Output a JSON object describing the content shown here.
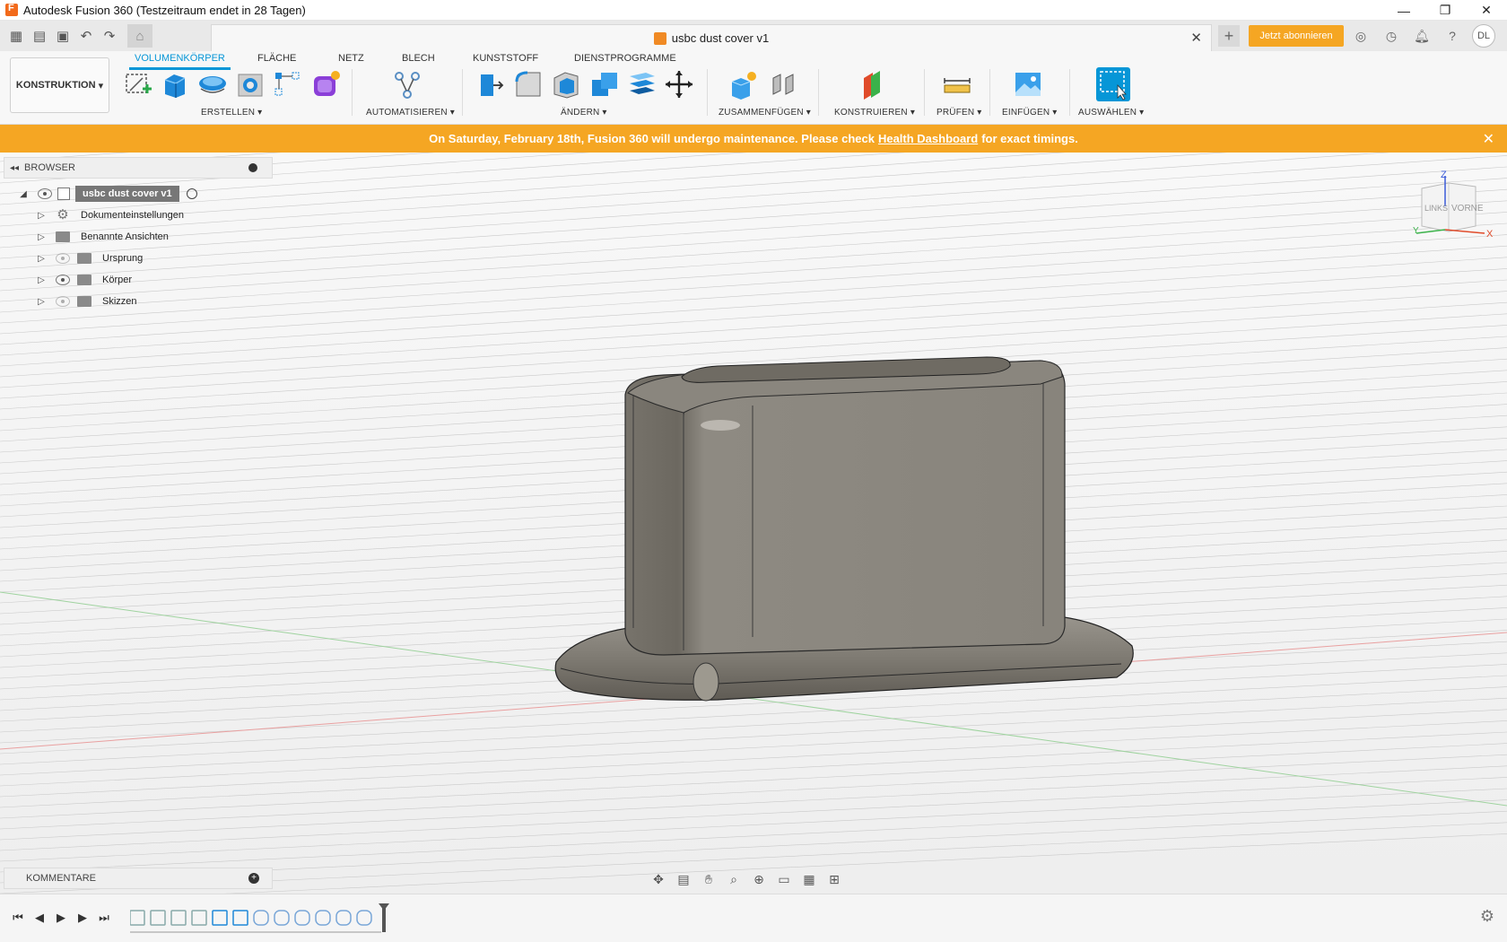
{
  "window": {
    "title": "Autodesk Fusion 360 (Testzeitraum endet in 28 Tagen)",
    "controls": [
      "—",
      "❐",
      "✕"
    ]
  },
  "document": {
    "tab_name": "usbc dust cover v1",
    "subscribe_label": "Jetzt abonnieren",
    "avatar_initials": "DL"
  },
  "toolbar": {
    "workspace": "KONSTRUKTION",
    "tabs": [
      "VOLUMENKÖRPER",
      "FLÄCHE",
      "NETZ",
      "BLECH",
      "KUNSTSTOFF",
      "DIENSTPROGRAMME"
    ],
    "active_tab": "VOLUMENKÖRPER",
    "groups": {
      "create": "ERSTELLEN",
      "automate": "AUTOMATISIEREN",
      "modify": "ÄNDERN",
      "assemble": "ZUSAMMENFÜGEN",
      "construct": "KONSTRUIEREN",
      "inspect": "PRÜFEN",
      "insert": "EINFÜGEN",
      "select": "AUSWÄHLEN"
    }
  },
  "banner": {
    "text_before": "On Saturday, February 18th, Fusion 360 will undergo maintenance. Please check",
    "link": "Health Dashboard",
    "text_after": "for exact timings.",
    "close": "✕"
  },
  "browser": {
    "title": "BROWSER",
    "root": "usbc dust cover v1",
    "items": [
      {
        "label": "Dokumenteinstellungen",
        "icon": "gear-icon",
        "eye": "none"
      },
      {
        "label": "Benannte Ansichten",
        "icon": "folder-icon",
        "eye": "none"
      },
      {
        "label": "Ursprung",
        "icon": "folder-icon",
        "eye": "hidden"
      },
      {
        "label": "Körper",
        "icon": "folder-icon",
        "eye": "visible"
      },
      {
        "label": "Skizzen",
        "icon": "folder-icon",
        "eye": "hidden"
      }
    ]
  },
  "comments": {
    "title": "KOMMENTARE"
  },
  "viewcube": {
    "z_label": "Z",
    "left_face": "LINKS",
    "front_face": "VORNE",
    "x_label": "X",
    "y_label": "Y"
  },
  "colors": {
    "accent": "#0696d7",
    "banner": "#f5a623",
    "model": "#8a857c"
  }
}
